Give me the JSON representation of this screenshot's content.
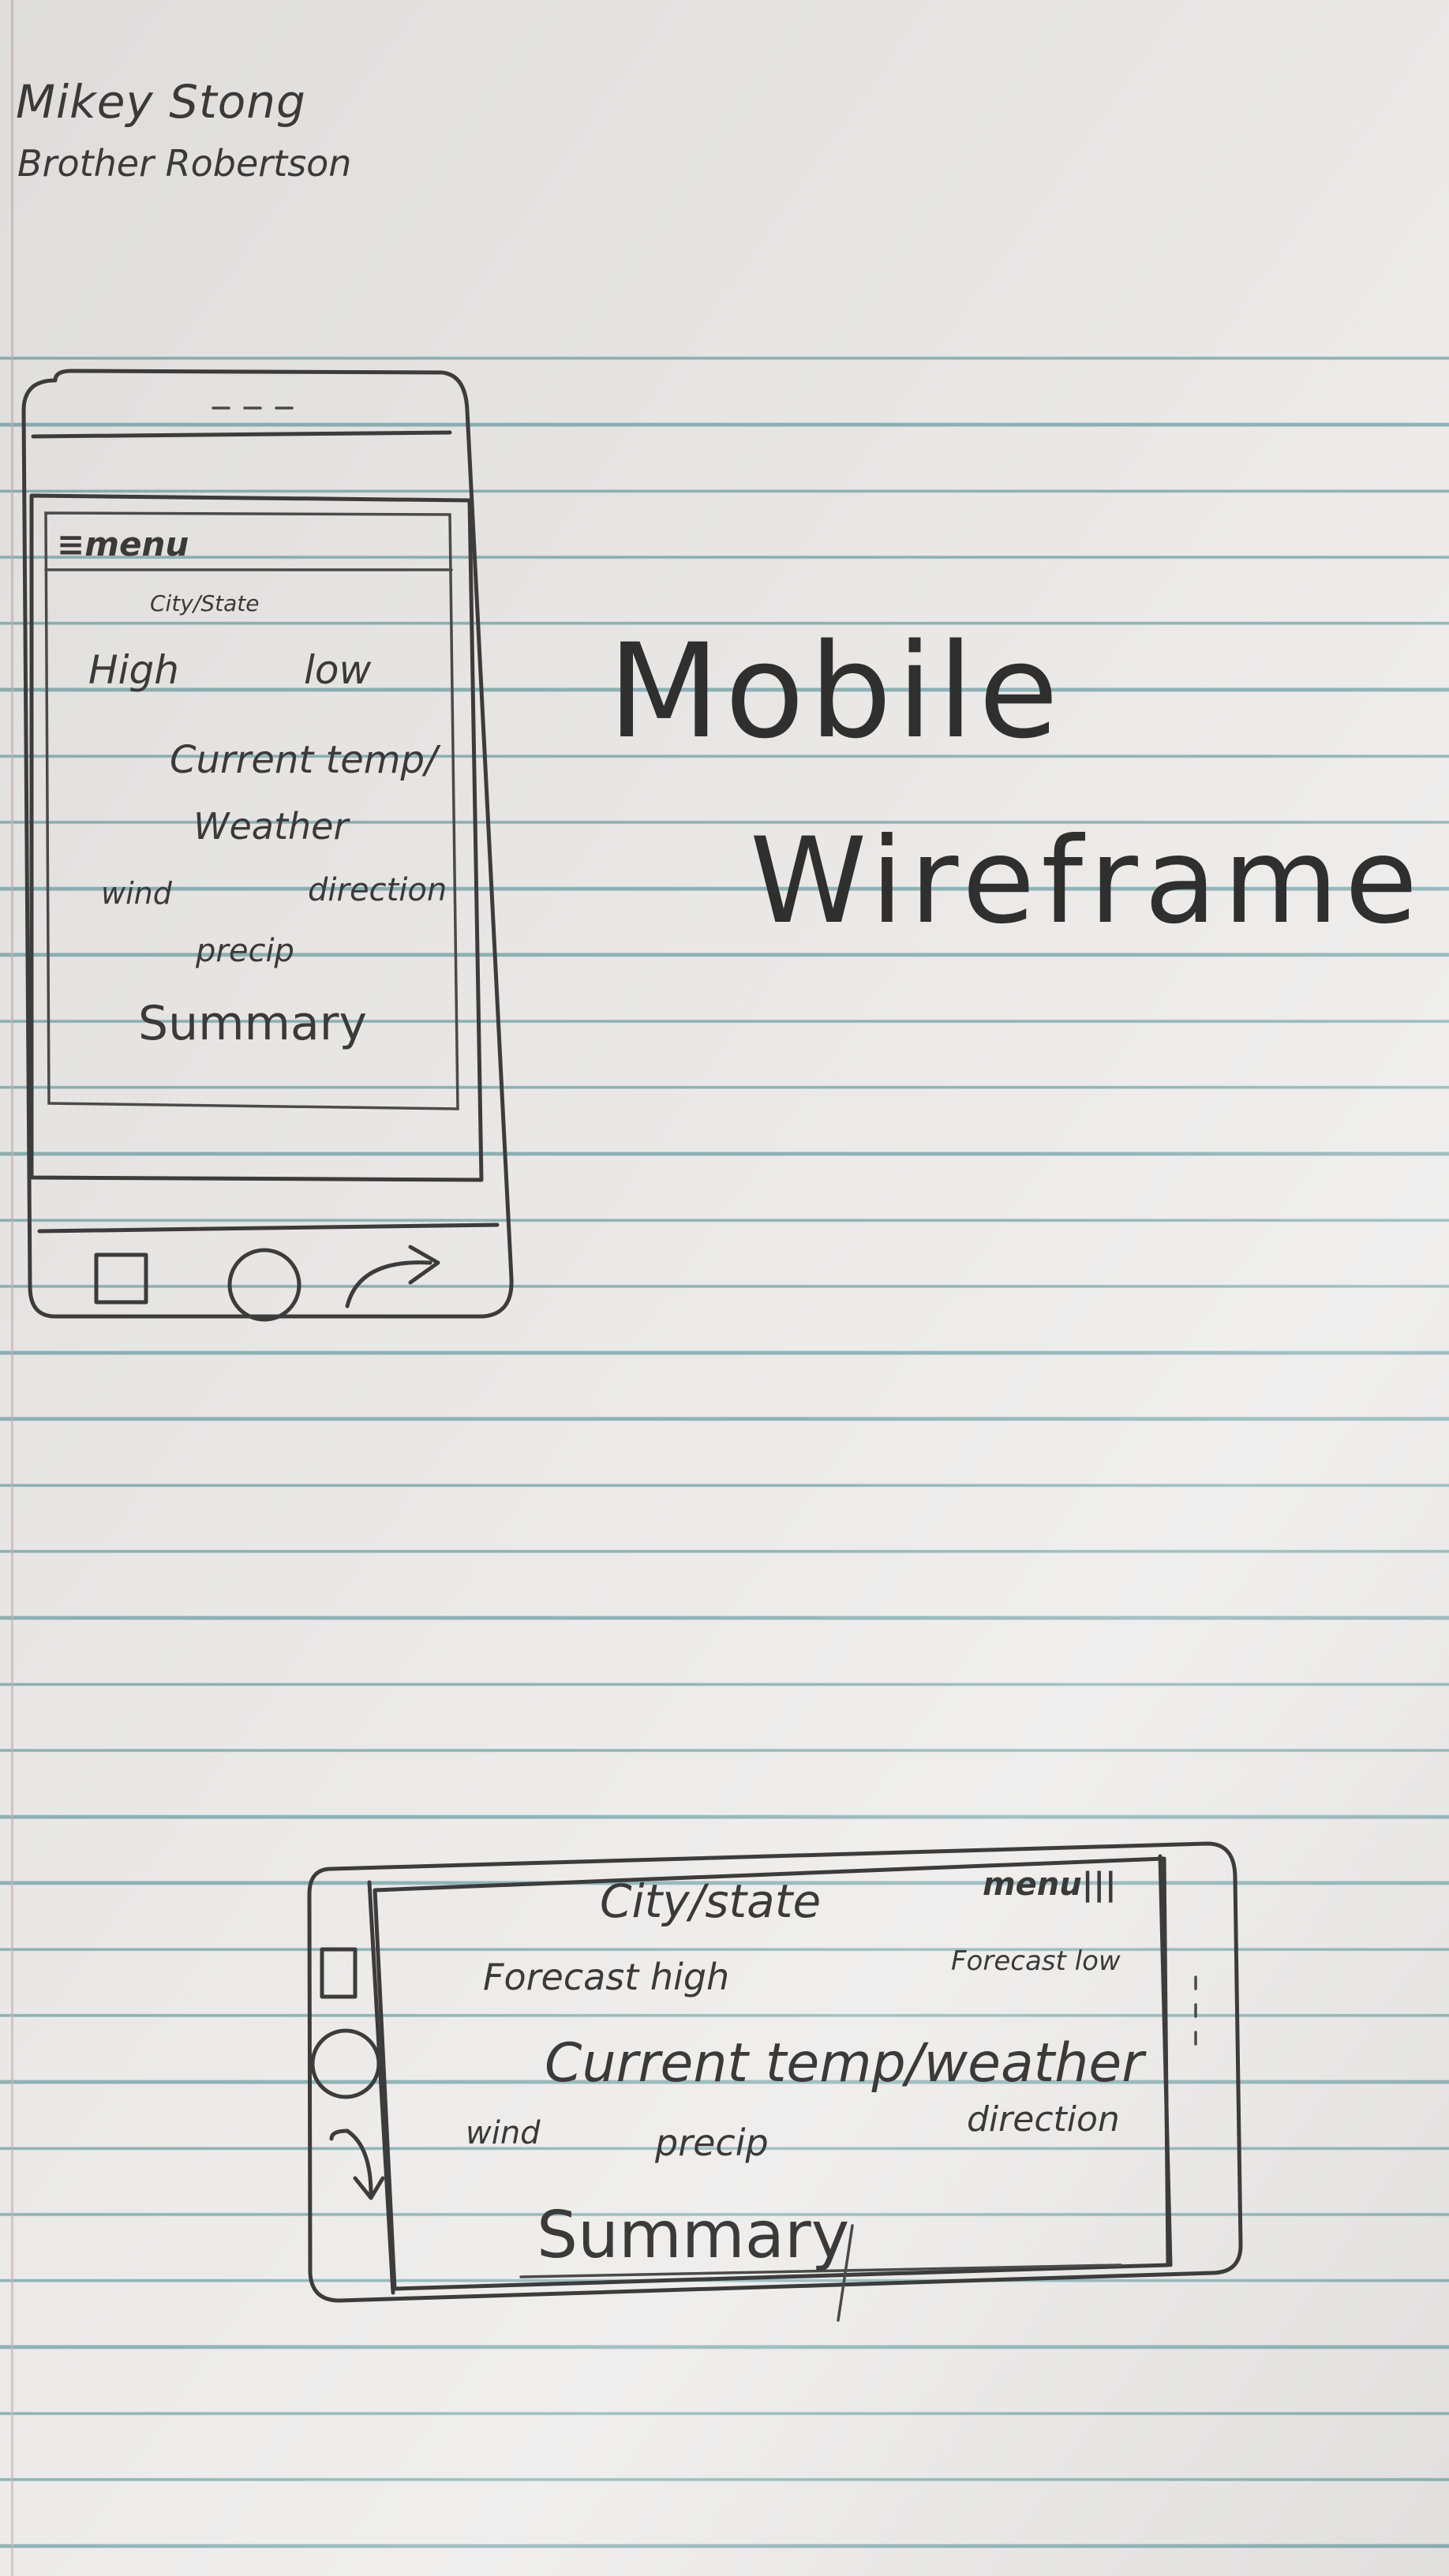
{
  "header": {
    "author": "Mikey Stong",
    "teacher": "Brother Robertson"
  },
  "title": {
    "line1": "Mobile",
    "line2": "Wireframe"
  },
  "portrait": {
    "menu_label": "≡menu",
    "city_state": "City/State",
    "high": "High",
    "low": "low",
    "current_temp": "Current temp/",
    "weather": "Weather",
    "wind": "wind",
    "direction": "direction",
    "precip": "precip",
    "summary": "Summary"
  },
  "landscape": {
    "city_state": "City/state",
    "menu_label": "menu|||",
    "forecast_high": "Forecast high",
    "forecast_low": "Forecast low",
    "current_temp_weather": "Current temp/weather",
    "wind": "wind",
    "precip": "precip",
    "direction": "direction",
    "summary": "Summary"
  }
}
